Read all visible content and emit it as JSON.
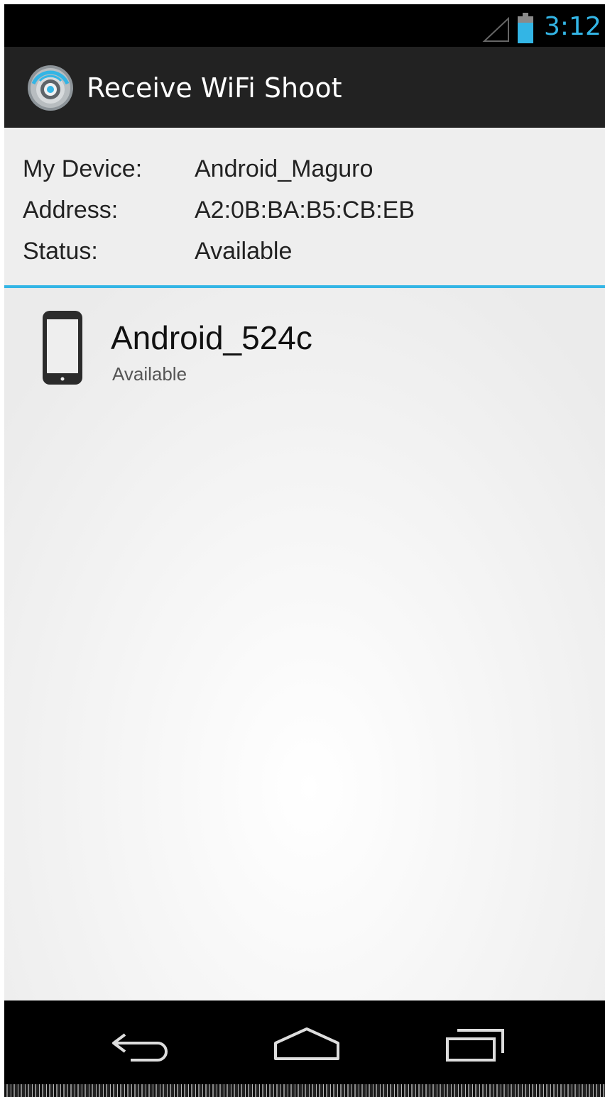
{
  "status_bar": {
    "time": "3:12",
    "signal_icon": "signal-triangle-icon",
    "battery_icon": "battery-icon"
  },
  "action_bar": {
    "title": "Receive WiFi Shoot",
    "app_icon": "wifi-radar-app-icon"
  },
  "device_info": {
    "rows": [
      {
        "label": "My Device:",
        "value": "Android_Maguro"
      },
      {
        "label": "Address:",
        "value": "A2:0B:BA:B5:CB:EB"
      },
      {
        "label": "Status:",
        "value": "Available"
      }
    ]
  },
  "peers": [
    {
      "name": "Android_524c",
      "status": "Available",
      "icon": "phone-icon"
    }
  ],
  "nav_bar": {
    "back_icon": "back-icon",
    "home_icon": "home-icon",
    "recents_icon": "recents-icon"
  },
  "colors": {
    "accent": "#33b5e5",
    "action_bar": "#222222",
    "status_bar": "#000000"
  }
}
